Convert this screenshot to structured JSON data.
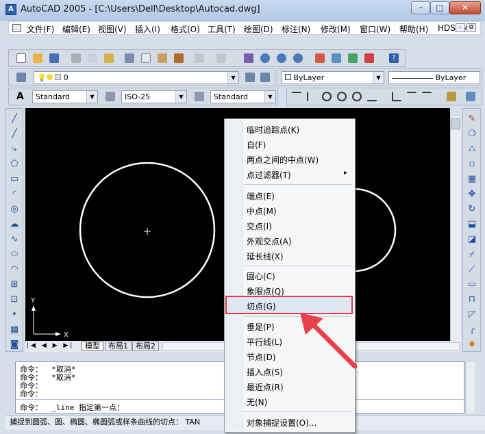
{
  "window": {
    "title": "AutoCAD 2005 - [C:\\Users\\Dell\\Desktop\\Autocad.dwg]",
    "minimize_glyph": "–",
    "maximize_glyph": "□",
    "close_glyph": "✕"
  },
  "menubar": {
    "items": [
      "文件(F)",
      "编辑(E)",
      "视图(V)",
      "插入(I)",
      "格式(O)",
      "工具(T)",
      "绘图(D)",
      "标注(N)",
      "修改(M)",
      "窗口(W)",
      "帮助(H)",
      "HDSHM"
    ]
  },
  "layers_toolbar": {
    "layer_value": "0",
    "color_value": "ByLayer",
    "linetype_value": "ByLayer"
  },
  "styles_toolbar": {
    "text_style": "Standard",
    "dim_style": "ISO-25",
    "table_style": "Standard"
  },
  "layout_tabs": [
    "模型",
    "布局1",
    "布局2"
  ],
  "ucs": {
    "x_label": "X",
    "y_label": "Y"
  },
  "command": {
    "lines": [
      "命令：  *取消*",
      "命令：  *取消*",
      "命令：",
      "命令："
    ],
    "prompt": "命令：  _line 指定第一点："
  },
  "statusbar": {
    "text": "捕捉到圆弧、圆、椭圆、椭圆弧或样条曲线的切点：   TAN"
  },
  "context_menu": {
    "group1": [
      "临时追踪点(K)",
      "自(F)",
      "两点之间的中点(W)",
      "点过滤器(T)"
    ],
    "group2": [
      "端点(E)",
      "中点(M)",
      "交点(I)",
      "外观交点(A)",
      "延长线(X)"
    ],
    "group3": [
      "圆心(C)",
      "象限点(Q)",
      "切点(G)"
    ],
    "group4": [
      "垂足(P)",
      "平行线(L)",
      "节点(D)",
      "插入点(S)",
      "最近点(R)",
      "无(N)"
    ],
    "group5": [
      "对象捕捉设置(O)..."
    ],
    "submenu_arrow": "▸"
  },
  "colors": {
    "highlight_border": "#e23b3b",
    "arrow": "#e8414a",
    "canvas": "#000000"
  }
}
